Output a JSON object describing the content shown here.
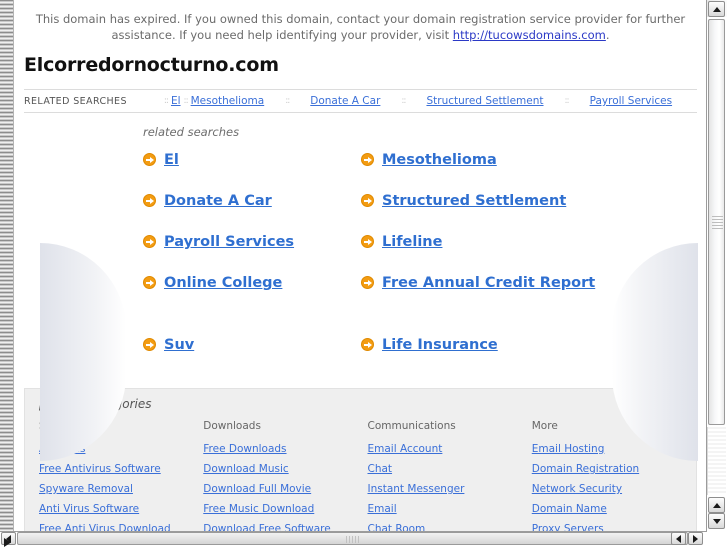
{
  "notice": {
    "text_before": "This domain has expired. If you owned this domain, contact your domain registration service provider for further assistance. If you need help identifying your provider, visit ",
    "link_text": "http://tucowsdomains.com",
    "text_after": "."
  },
  "domain": {
    "title": "Elcorredornocturno.com"
  },
  "related_searches_bar": {
    "label": "RELATED SEARCHES",
    "separator": "::",
    "items": [
      {
        "label": "El"
      },
      {
        "label": "Mesothelioma"
      },
      {
        "label": "Donate A Car"
      },
      {
        "label": "Structured Settlement"
      },
      {
        "label": "Payroll Services"
      }
    ]
  },
  "related_searches_main": {
    "heading": "related searches",
    "column_left": [
      {
        "label": "El"
      },
      {
        "label": "Donate A Car"
      },
      {
        "label": "Payroll Services"
      },
      {
        "label": "Online College"
      },
      {
        "label": "Suv"
      }
    ],
    "column_right": [
      {
        "label": "Mesothelioma"
      },
      {
        "label": "Structured Settlement"
      },
      {
        "label": "Lifeline"
      },
      {
        "label": "Free Annual Credit Report"
      },
      {
        "label": "Life Insurance"
      }
    ]
  },
  "popular_categories": {
    "heading": "popular categories",
    "columns": [
      {
        "title": "Security",
        "links": [
          "Antivirus",
          "Free Antivirus Software",
          "Spyware Removal",
          "Anti Virus Software",
          "Free Anti Virus Download"
        ]
      },
      {
        "title": "Downloads",
        "links": [
          "Free Downloads",
          "Download Music",
          "Download Full Movie",
          "Free Music Download",
          "Download Free Software"
        ]
      },
      {
        "title": "Communications",
        "links": [
          "Email Account",
          "Chat",
          "Instant Messenger",
          "Email",
          "Chat Room"
        ]
      },
      {
        "title": "More",
        "links": [
          "Email Hosting",
          "Domain Registration",
          "Network Security",
          "Domain Name",
          "Proxy Servers"
        ]
      }
    ]
  },
  "colors": {
    "link_blue": "#3a6fd8",
    "heading_link_blue": "#2f6fd0",
    "notice_link": "#2b39c6",
    "bullet_orange": "#f39c12",
    "panel_gray": "#efefef"
  },
  "icons": {
    "bullet": "arrow-circle-right-icon",
    "scroll_up": "scroll-up-arrow-icon",
    "scroll_down": "scroll-down-arrow-icon",
    "scroll_left": "scroll-left-arrow-icon",
    "scroll_right": "scroll-right-arrow-icon",
    "resize": "resize-grip-icon"
  }
}
